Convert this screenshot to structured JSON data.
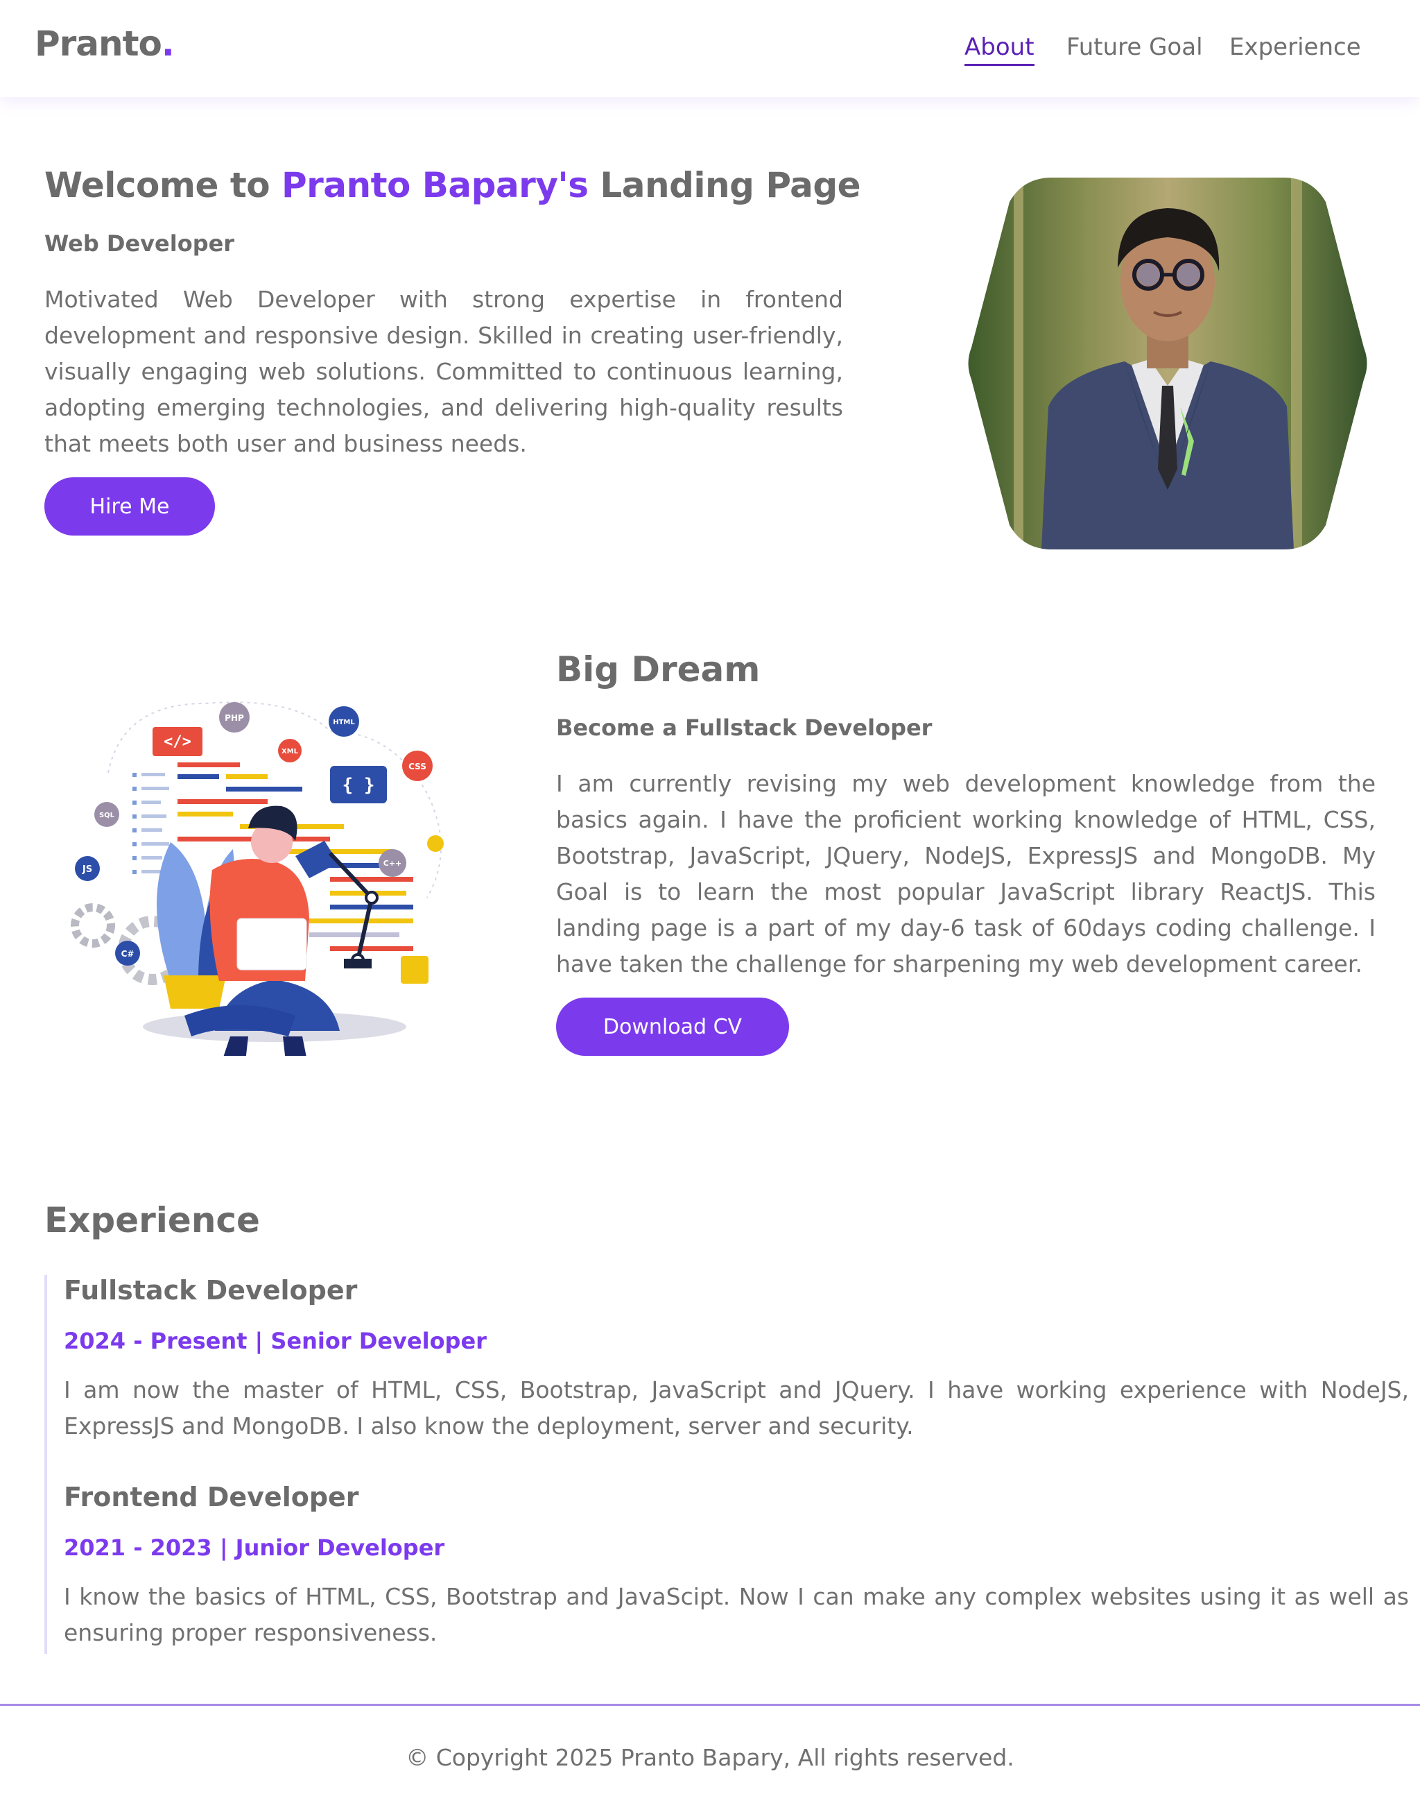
{
  "nav": {
    "brand": "Pranto",
    "brand_dot": ".",
    "links": [
      "About",
      "Future Goal",
      "Experience"
    ]
  },
  "hero": {
    "title_prefix": "Welcome to ",
    "title_name": "Pranto Bapary's",
    "title_suffix": " Landing Page",
    "subtitle": "Web Developer",
    "description": "Motivated Web Developer with strong expertise in frontend development and responsive design. Skilled in creating user-friendly, visually engaging web solutions. Committed to continuous learning, adopting emerging technologies, and delivering high-quality results that meets both user and business needs.",
    "button": "Hire Me"
  },
  "dream": {
    "title": "Big Dream",
    "subtitle": "Become a Fullstack Developer",
    "description": "I am currently revising my web development knowledge from the basics again. I have the proficient working knowledge of HTML, CSS, Bootstrap, JavaScript, JQuery, NodeJS, ExpressJS and MongoDB. My Goal is to learn the most popular JavaScript library ReactJS. This landing page is a part of my day-6 task of 60days coding challenge. I have taken the challenge for sharpening my web development career.",
    "button": "Download CV",
    "illustration_badges": [
      "PHP",
      "HTML",
      "XML",
      "CSS",
      "SQL",
      "JS",
      "C++",
      "C#",
      "</>",
      "{ }"
    ]
  },
  "experience": {
    "title": "Experience",
    "items": [
      {
        "role": "Fullstack Developer",
        "meta": "2024 - Present | Senior Developer",
        "description": "I am now the master of HTML, CSS, Bootstrap, JavaScript and JQuery. I have working experience with NodeJS, ExpressJS and MongoDB. I also know the deployment, server and security."
      },
      {
        "role": "Frontend Developer",
        "meta": "2021 - 2023 | Junior Developer",
        "description": "I know the basics of HTML, CSS, Bootstrap and JavaScipt. Now I can make any complex websites using it as well as ensuring proper responsiveness."
      }
    ]
  },
  "footer": {
    "text": "© Copyright 2025 Pranto Bapary, All rights reserved."
  },
  "colors": {
    "accent": "#7c3aed",
    "nav_active": "#5b21b6",
    "text": "#6e6e6e"
  }
}
